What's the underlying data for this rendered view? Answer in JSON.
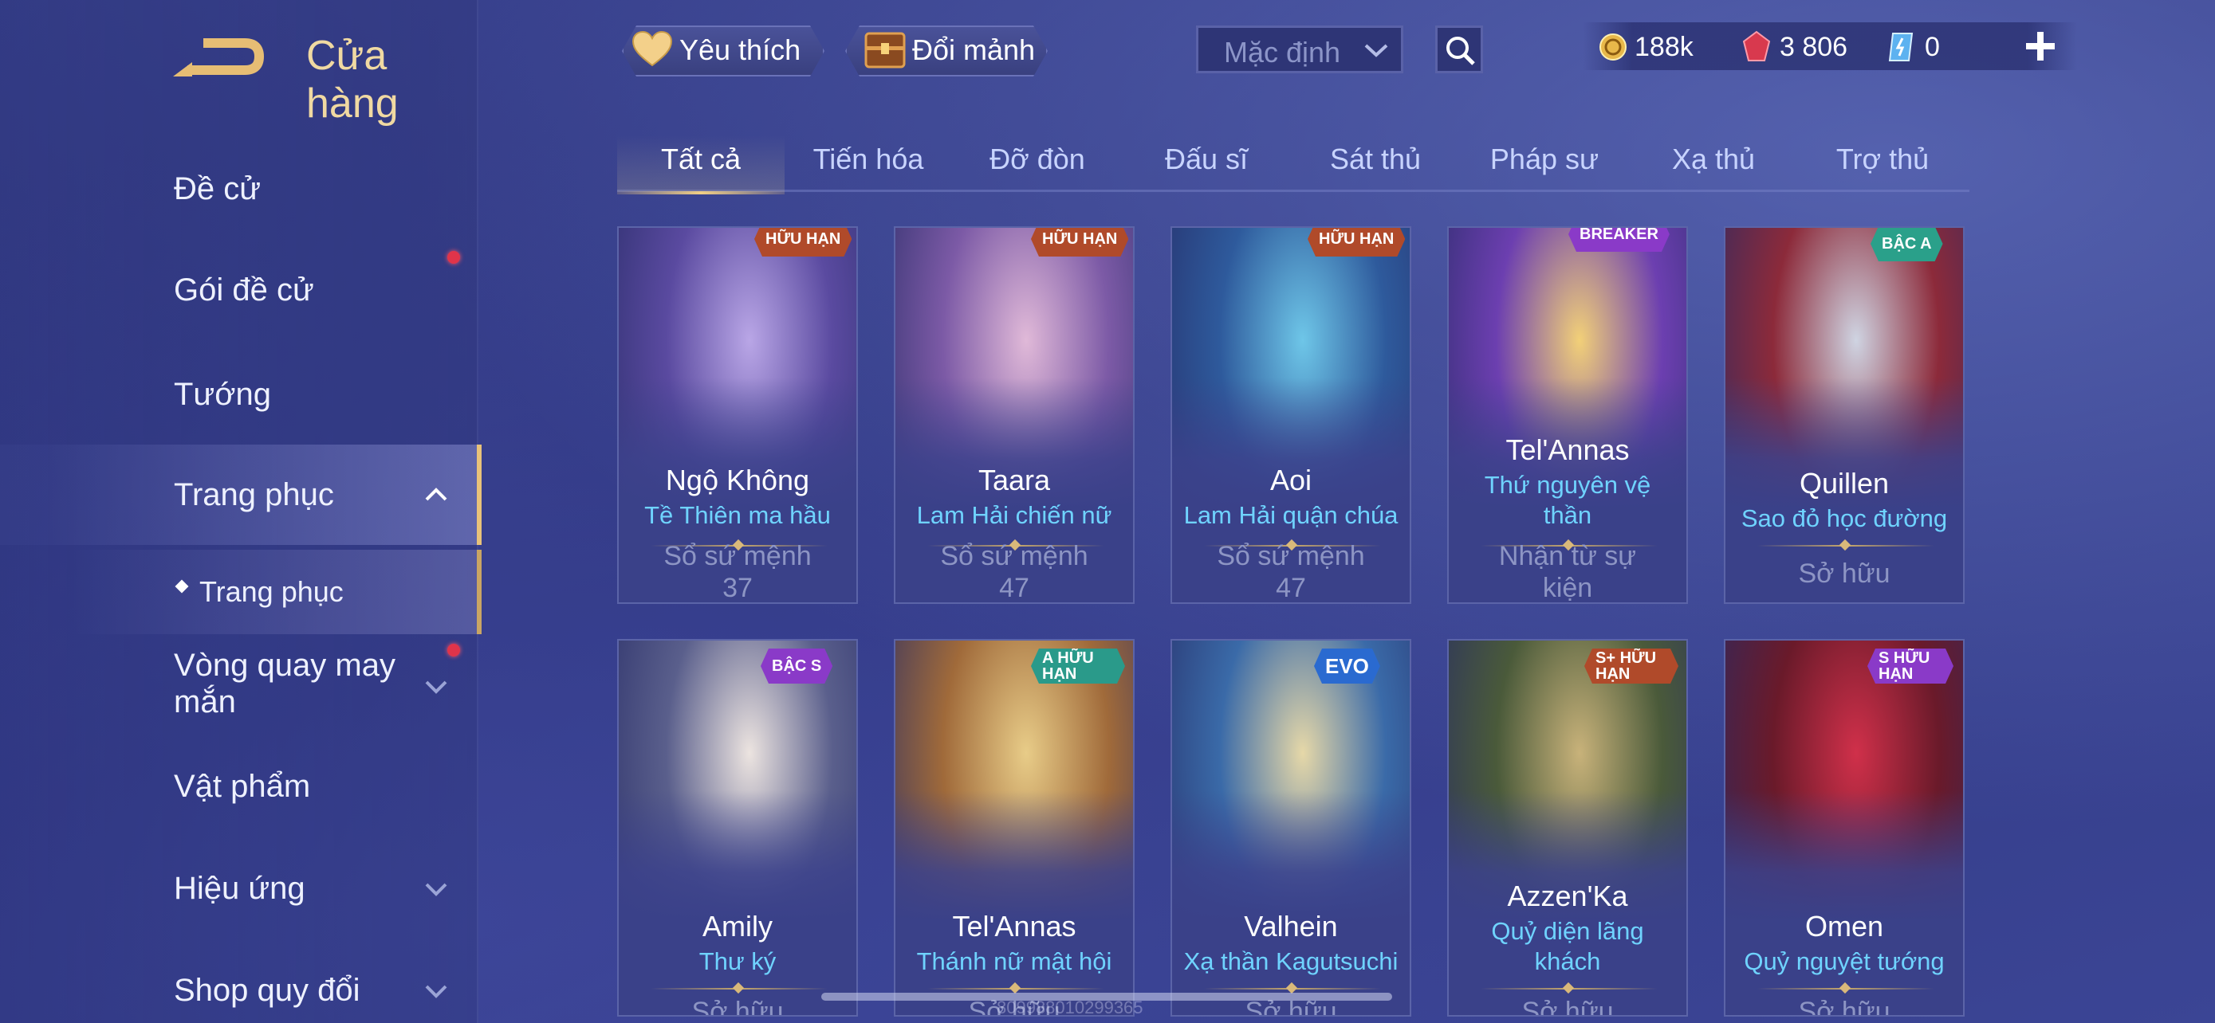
{
  "header": {
    "title": "Cửa hàng",
    "favorites_label": "Yêu thích",
    "exchange_label": "Đổi mảnh",
    "sort_selected": "Mặc định",
    "currencies": [
      {
        "icon": "gold-coin-icon",
        "value": "188k"
      },
      {
        "icon": "red-gem-icon",
        "value": "3 806"
      },
      {
        "icon": "blue-voucher-icon",
        "value": "0"
      }
    ]
  },
  "sidebar": {
    "items": [
      {
        "label": "Đề cử"
      },
      {
        "label": "Gói đề cử",
        "notification": true
      },
      {
        "label": "Tướng"
      },
      {
        "label": "Trang phục",
        "expanded": true,
        "active": true
      },
      {
        "label": "Trang phục",
        "sub": true
      },
      {
        "label": "Vòng quay may mắn",
        "notification": true
      },
      {
        "label": "Vật phẩm"
      },
      {
        "label": "Hiệu ứng"
      },
      {
        "label": "Shop quy đổi"
      }
    ]
  },
  "tabs": [
    "Tất cả",
    "Tiến hóa",
    "Đỡ đòn",
    "Đấu sĩ",
    "Sát thủ",
    "Pháp sư",
    "Xạ thủ",
    "Trợ thủ"
  ],
  "active_tab": "Tất cả",
  "cards": [
    {
      "hero": "Ngộ Không",
      "skin": "Tề Thiên ma hầu",
      "status": "Sổ sứ mệnh 37",
      "badge": "HỮU HẠN",
      "colors": [
        "#5a4aa0",
        "#b9a6e6"
      ]
    },
    {
      "hero": "Taara",
      "skin": "Lam Hải chiến nữ",
      "status": "Sổ sứ mệnh 47",
      "badge": "HỮU HẠN",
      "colors": [
        "#7c5aa6",
        "#e0b9d8"
      ]
    },
    {
      "hero": "Aoi",
      "skin": "Lam Hải quận chúa",
      "status": "Sổ sứ mệnh 47",
      "badge": "HỮU HẠN",
      "colors": [
        "#2e5a9c",
        "#6ec6e8"
      ]
    },
    {
      "hero": "Tel'Annas",
      "skin": "Thứ nguyên vệ thần",
      "status": "Nhận từ sự kiện",
      "badge": "BREAKER",
      "colors": [
        "#6c3fb0",
        "#f2d078"
      ]
    },
    {
      "hero": "Quillen",
      "skin": "Sao đỏ học đường",
      "status": "Sở hữu",
      "badge": "BẬC A",
      "colors": [
        "#8c2a3a",
        "#cfd4e2"
      ]
    },
    {
      "hero": "Amily",
      "skin": "Thư ký",
      "status": "Sở hữu",
      "badge": "BẬC S",
      "colors": [
        "#5a5f8c",
        "#ece4e0"
      ]
    },
    {
      "hero": "Tel'Annas",
      "skin": "Thánh nữ mật hội",
      "status": "Sở hữu",
      "badge": "A HỮU HẠN",
      "colors": [
        "#a06a3a",
        "#e8cc88"
      ]
    },
    {
      "hero": "Valhein",
      "skin": "Xạ thần Kagutsuchi",
      "status": "Sở hữu",
      "badge": "EVO",
      "colors": [
        "#3a6aa8",
        "#e6d8a8"
      ]
    },
    {
      "hero": "Azzen'Ka",
      "skin": "Quỷ diện lãng khách",
      "status": "Sở hữu",
      "badge": "S+ HỮU HẠN",
      "colors": [
        "#4a5a3a",
        "#c8b27a"
      ]
    },
    {
      "hero": "Omen",
      "skin": "Quỷ nguyệt tướng",
      "status": "Sở hữu",
      "badge": "S HỮU HẠN",
      "colors": [
        "#6a1a2a",
        "#d0304a"
      ]
    }
  ],
  "watermark": "809988010299365"
}
